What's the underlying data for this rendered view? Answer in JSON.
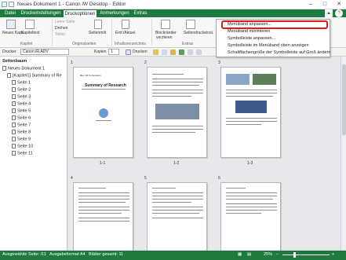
{
  "window": {
    "title": "Neues Dokument 1 - Canon iW Desktop - Editor"
  },
  "tabs": [
    "Datei",
    "Druckeinstellungen",
    "Druckoptionen",
    "Anmerkungen",
    "Extras"
  ],
  "ribbon": {
    "new_kaps": "Neues Kaps.",
    "kapiteltitel": "Kapiteltext",
    "leere_seite": "Leere Seite",
    "drehen": "Drehen",
    "teilen": "Teilen",
    "seitenmitte": "Seitenmitt",
    "einf_aktuel": "Einf./Aktuel.",
    "blockrander": "Blockränder",
    "verzierung": "verzieren",
    "seitendruck": "Seitendruckeinst.",
    "group_kapitel": "Kapitel",
    "group_original": "Originalseiten",
    "group_inhalt": "Inhaltsverzeichnis",
    "group_extras": "Extras"
  },
  "toolbar": {
    "drucker_label": "Drucker",
    "drucker_value": "Canon iR-ADV",
    "kopien_label": "Kopien",
    "kopien_value": "1",
    "drucken_label": "Drucken"
  },
  "menu": {
    "items": [
      "Menüband anpassen...",
      "Menüband minimieren",
      "Symbolleiste anpassen...",
      "Symbolleiste im Menüband oben anzeigen",
      "Schaltflächengröße der Symbolleiste auf Groß ändern"
    ]
  },
  "sidebar": {
    "header": "Seitenbaum",
    "root": "Neues Dokument 1",
    "chapter": "[Kapitel1] Summary of Re",
    "pages": [
      "Seite 1",
      "Seite 2",
      "Seite 3",
      "Seite 4",
      "Seite 5",
      "Seite 6",
      "Seite 7",
      "Seite 8",
      "Seite 9",
      "Seite 10",
      "Seite 11"
    ]
  },
  "pages": {
    "row1_numbers": [
      "1",
      "2",
      "3"
    ],
    "row1_labels": [
      "1-1",
      "1-2",
      "1-3"
    ],
    "row2_numbers": [
      "4",
      "5",
      "6"
    ],
    "page1_title": "Summary of Research",
    "page1_header": "Rev. 00 Corporation"
  },
  "statusbar": {
    "selected": "Ausgewählte Seite: /11",
    "format": "Ausgabeformat:A4",
    "sheets": "Blätter gesamt: 11",
    "zoom": "25%"
  }
}
